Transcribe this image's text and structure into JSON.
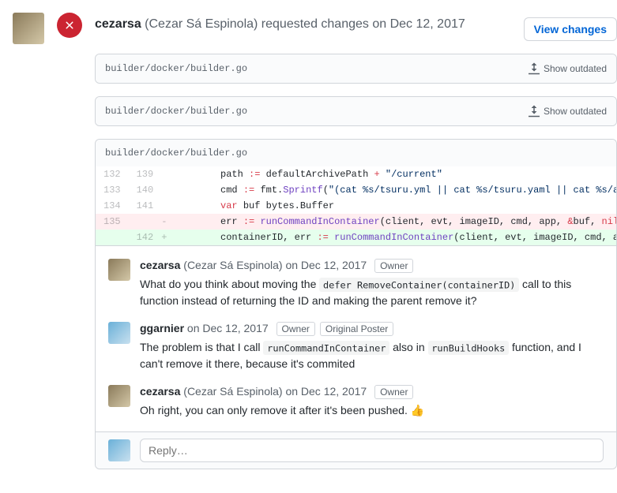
{
  "review": {
    "author_username": "cezarsa",
    "author_display": "(Cezar Sá Espinola)",
    "action_text": "requested changes on Dec 12, 2017",
    "view_changes_label": "View changes"
  },
  "files": [
    {
      "path": "builder/docker/builder.go",
      "toggle_label": "Show outdated"
    },
    {
      "path": "builder/docker/builder.go",
      "toggle_label": "Show outdated"
    }
  ],
  "diff": {
    "path": "builder/docker/builder.go",
    "lines": [
      {
        "old": "132",
        "new": "139",
        "type": "ctx",
        "html": "        path <span class='tok-k'>:=</span> defaultArchivePath <span class='tok-k'>+</span> <span class='tok-s'>\"/current\"</span>"
      },
      {
        "old": "133",
        "new": "140",
        "type": "ctx",
        "html": "        cmd <span class='tok-k'>:=</span> fmt.<span class='tok-f'>Sprintf</span>(<span class='tok-s'>\"(cat %s/tsuru.yml || cat %s/tsuru.yaml || cat %s/ap</span>"
      },
      {
        "old": "134",
        "new": "141",
        "type": "ctx",
        "html": "        <span class='tok-k'>var</span> buf bytes.Buffer"
      },
      {
        "old": "135",
        "new": "",
        "type": "del",
        "html": "        err <span class='tok-k'>:=</span> <span class='tok-f'>runCommandInContainer</span>(client, evt, imageID, cmd, app, <span class='tok-k'>&amp;</span>buf, <span class='tok-k'>nil</span>)"
      },
      {
        "old": "",
        "new": "142",
        "type": "add",
        "html": "        containerID, err <span class='tok-k'>:=</span> <span class='tok-f'>runCommandInContainer</span>(client, evt, imageID, cmd, ap"
      }
    ]
  },
  "comments": [
    {
      "username": "cezarsa",
      "display": "(Cezar Sá Espinola)",
      "timestamp": "on Dec 12, 2017",
      "badges": [
        "Owner"
      ],
      "body_html": "What do you think about moving the <code>defer RemoveContainer(containerID)</code> call to this function instead of returning the ID and making the parent remove it?",
      "avatar_class": "a1"
    },
    {
      "username": "ggarnier",
      "display": "",
      "timestamp": "on Dec 12, 2017",
      "badges": [
        "Owner",
        "Original Poster"
      ],
      "body_html": "The problem is that I call <code>runCommandInContainer</code> also in <code>runBuildHooks</code> function, and I can't remove it there, because it's commited",
      "avatar_class": "a2"
    },
    {
      "username": "cezarsa",
      "display": "(Cezar Sá Espinola)",
      "timestamp": "on Dec 12, 2017",
      "badges": [
        "Owner"
      ],
      "body_html": "Oh right, you can only remove it after it's been pushed. 👍",
      "avatar_class": "a1"
    }
  ],
  "reply": {
    "placeholder": "Reply…"
  }
}
